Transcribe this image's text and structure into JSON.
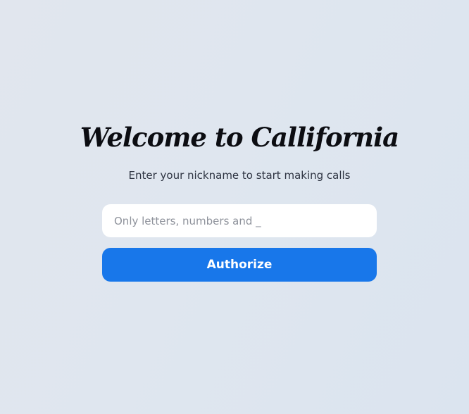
{
  "welcome": {
    "title": "Welcome to Callifornia",
    "subtitle": "Enter your nickname to start making calls"
  },
  "nickname_input": {
    "value": "",
    "placeholder": "Only letters, numbers and _"
  },
  "authorize_button": {
    "label": "Authorize"
  },
  "colors": {
    "background": "#dfe6ef",
    "button": "#1877ea",
    "title_text": "#0c0d12"
  }
}
